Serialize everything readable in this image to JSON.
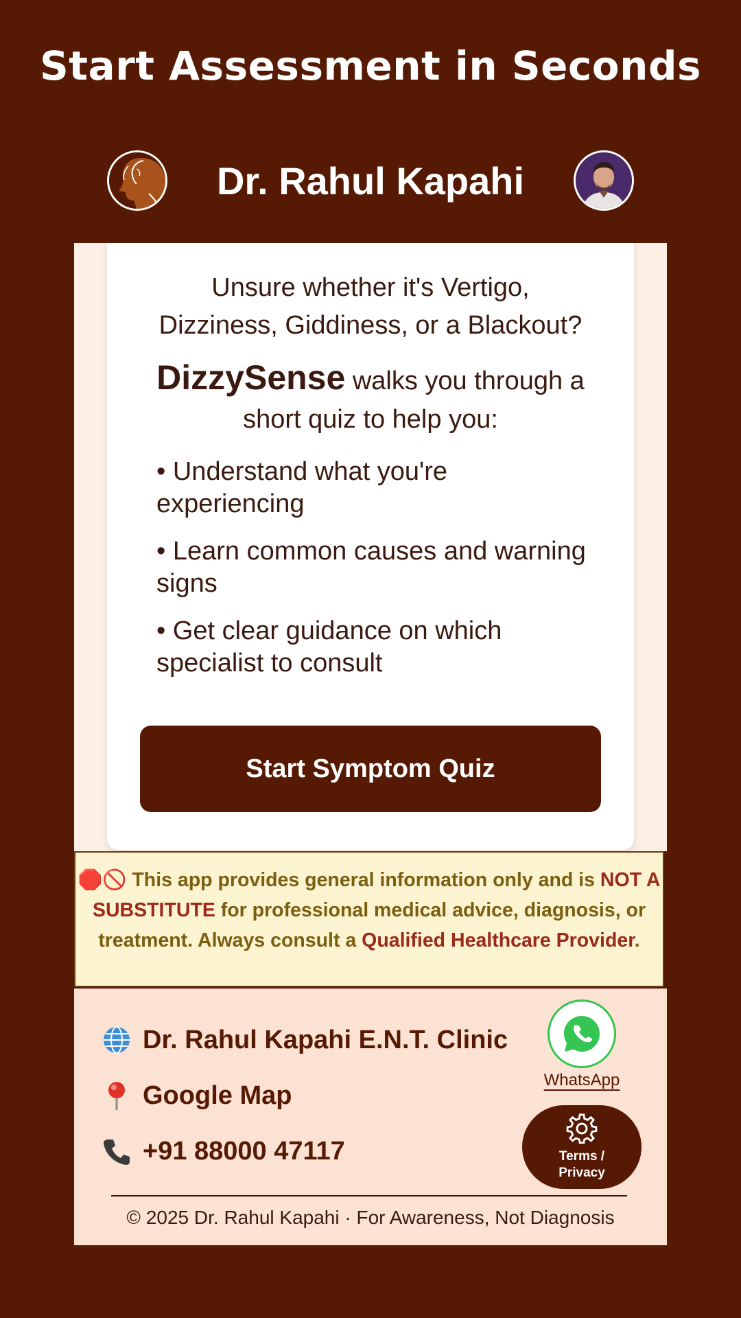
{
  "promo": {
    "title": "Start Assessment in Seconds"
  },
  "header": {
    "title": "Dr. Rahul Kapahi",
    "logo_icon": "head-silhouette-icon",
    "avatar_icon": "doctor-avatar"
  },
  "card": {
    "intro_line1": "Unsure whether it's Vertigo,",
    "intro_line2": "Dizziness, Giddiness, or a Blackout?",
    "brand": "DizzySense",
    "desc_rest": "walks you through a",
    "desc_line2": "short quiz to help you:",
    "benefits": [
      "• Understand what you're experiencing",
      "• Learn common causes and warning signs",
      "• Get clear guidance on which specialist to consult"
    ],
    "cta_label": "Start Symptom Quiz"
  },
  "disclaimer": {
    "icons": "🛑🚫",
    "part1": " This app provides general information only and is ",
    "emph1": "NOT A SUBSTITUTE",
    "part2": " for professional medical advice, diagnosis, or treatment. Always consult a ",
    "emph2": "Qualified Healthcare Provider",
    "part3": "."
  },
  "footer": {
    "clinic": {
      "icon": "globe-icon",
      "label": "Dr. Rahul Kapahi E.N.T. Clinic"
    },
    "map": {
      "icon": "map-pin-icon",
      "label": "Google Map"
    },
    "phone": {
      "icon": "phone-icon",
      "label": "+91 88000 47117"
    },
    "whatsapp_label": "WhatsApp",
    "settings_label": "Terms / Privacy",
    "copyright": "© 2025 Dr. Rahul Kapahi · For Awareness, Not Diagnosis"
  },
  "colors": {
    "brand": "#561904",
    "panel": "#fbefe6",
    "footer_bg": "#fce2d2",
    "disclaimer_bg": "#fcf3d0",
    "whatsapp": "#35c553"
  }
}
